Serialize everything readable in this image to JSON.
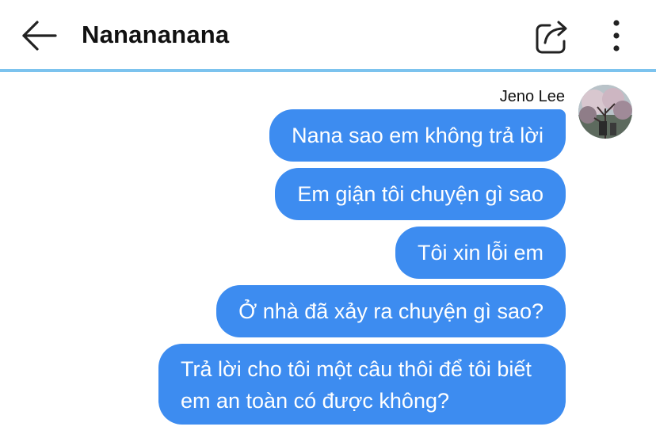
{
  "header": {
    "title": "Nanananana",
    "back_icon": "arrow-left-icon",
    "share_icon": "share-icon",
    "more_icon": "more-vertical-icon",
    "divider_color": "#7cc3ee"
  },
  "conversation": {
    "sender_name": "Jeno Lee",
    "bubble_color": "#3d8cf0",
    "messages": [
      {
        "text": "Nana sao em không trả lời"
      },
      {
        "text": "Em giận tôi chuyện gì sao"
      },
      {
        "text": "Tôi xin lỗi em"
      },
      {
        "text": "Ở nhà đã xảy ra chuyện gì sao?"
      },
      {
        "text": "Trả lời cho tôi một câu thôi để tôi biết em an toàn có được không?"
      }
    ]
  }
}
